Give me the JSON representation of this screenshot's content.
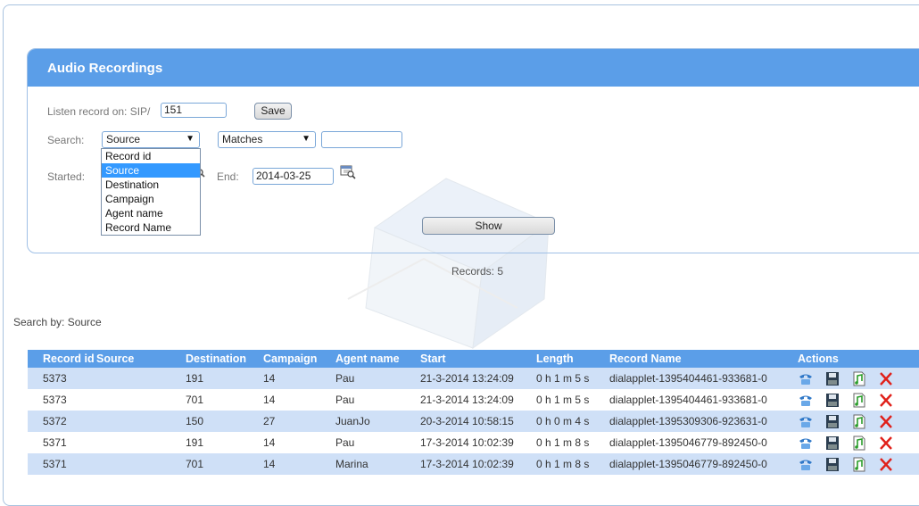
{
  "panel": {
    "title": "Audio Recordings"
  },
  "listen": {
    "label": "Listen record on: SIP/",
    "value": "151",
    "save_label": "Save"
  },
  "search": {
    "label": "Search:",
    "field_selected": "Source",
    "field_options": [
      "Record id",
      "Source",
      "Destination",
      "Campaign",
      "Agent name",
      "Record Name"
    ],
    "match_selected": "Matches",
    "value": ""
  },
  "dates": {
    "started_label": "Started:",
    "end_label": "End:",
    "end_value": "2014-03-25"
  },
  "show_label": "Show",
  "records_count": "Records: 5",
  "search_by": "Search by:  Source",
  "table": {
    "headers": [
      "Record id",
      "Source",
      "Destination",
      "Campaign",
      "Agent name",
      "Start",
      "Length",
      "Record Name",
      "Actions"
    ],
    "rows": [
      [
        "5373",
        "",
        "191",
        "14",
        "Pau",
        "21-3-2014 13:24:09",
        "0 h 1 m 5 s",
        "dialapplet-1395404461-933681-0"
      ],
      [
        "5373",
        "",
        "701",
        "14",
        "Pau",
        "21-3-2014 13:24:09",
        "0 h 1 m 5 s",
        "dialapplet-1395404461-933681-0"
      ],
      [
        "5372",
        "",
        "150",
        "27",
        "JuanJo",
        "20-3-2014 10:58:15",
        "0 h 0 m 4 s",
        "dialapplet-1395309306-923631-0"
      ],
      [
        "5371",
        "",
        "191",
        "14",
        "Pau",
        "17-3-2014 10:02:39",
        "0 h 1 m 8 s",
        "dialapplet-1395046779-892450-0"
      ],
      [
        "5371",
        "",
        "701",
        "14",
        "Marina",
        "17-3-2014 10:02:39",
        "0 h 1 m 8 s",
        "dialapplet-1395046779-892450-0"
      ]
    ]
  },
  "icons": {
    "call": "phone-icon",
    "save": "floppy-disk-icon",
    "play": "audio-file-icon",
    "delete": "delete-x-icon",
    "calendar": "calendar-search-icon"
  },
  "colors": {
    "header_blue": "#5b9ee8",
    "row_alt": "#cfe0f7",
    "delete_red": "#e0201a"
  }
}
